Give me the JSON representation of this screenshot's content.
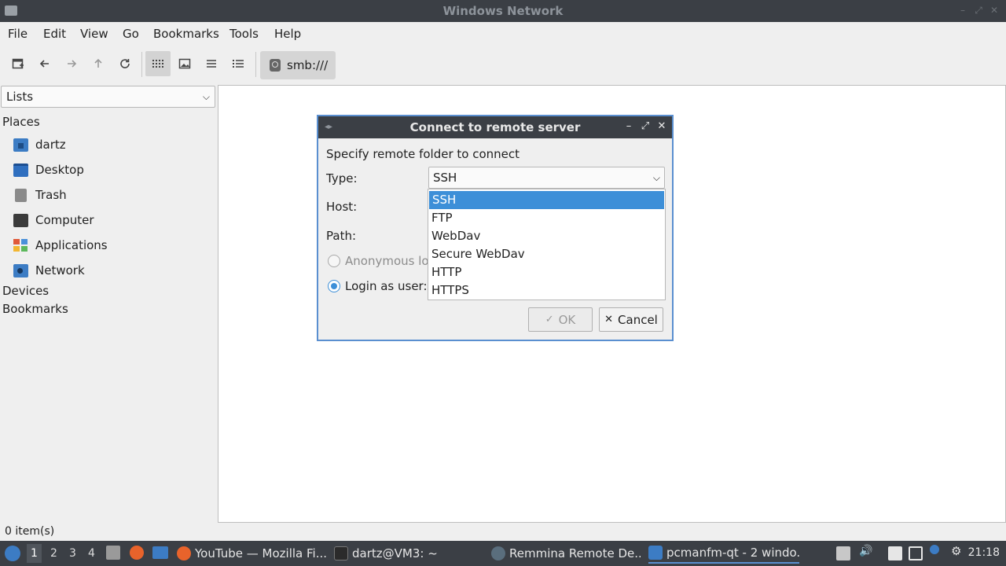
{
  "window": {
    "title": "Windows Network"
  },
  "menubar": [
    "File",
    "Edit",
    "View",
    "Go",
    "Bookmarks",
    "Tools",
    "Help"
  ],
  "toolbar": {
    "path": "smb:///"
  },
  "sidebar": {
    "selector": "Lists",
    "places_header": "Places",
    "places": [
      {
        "label": "dartz",
        "icon": "home-folder-icon"
      },
      {
        "label": "Desktop",
        "icon": "desktop-icon"
      },
      {
        "label": "Trash",
        "icon": "trash-icon"
      },
      {
        "label": "Computer",
        "icon": "computer-icon"
      },
      {
        "label": "Applications",
        "icon": "applications-icon"
      },
      {
        "label": "Network",
        "icon": "network-icon"
      }
    ],
    "devices_header": "Devices",
    "bookmarks_header": "Bookmarks"
  },
  "status": {
    "items": "0 item(s)"
  },
  "dialog": {
    "title": "Connect to remote server",
    "prompt": "Specify remote folder to connect",
    "type_label": "Type:",
    "type_value": "SSH",
    "type_options": [
      "SSH",
      "FTP",
      "WebDav",
      "Secure WebDav",
      "HTTP",
      "HTTPS"
    ],
    "selected_option": "SSH",
    "host_label": "Host:",
    "path_label": "Path:",
    "anonymous_label": "Anonymous log",
    "login_label": "Login as user:",
    "ok_label": "OK",
    "cancel_label": "Cancel"
  },
  "taskbar": {
    "workspaces": [
      "1",
      "2",
      "3",
      "4"
    ],
    "current_workspace": "1",
    "tasks": [
      {
        "label": "YouTube — Mozilla Fi...",
        "icon": "firefox-icon"
      },
      {
        "label": "dartz@VM3: ~",
        "icon": "terminal-icon"
      },
      {
        "label": "Remmina Remote De...",
        "icon": "remmina-icon"
      },
      {
        "label": "pcmanfm-qt - 2 windo...",
        "icon": "folder-icon"
      }
    ],
    "clock": "21:18"
  },
  "colors": {
    "accent": "#3d8fd8",
    "titlebar": "#3b3f45",
    "panel": "#efefef"
  }
}
